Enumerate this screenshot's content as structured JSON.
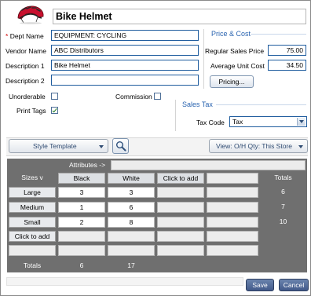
{
  "item": {
    "title": "Bike Helmet",
    "image_icon": "helmet-icon"
  },
  "form": {
    "dept_label": "Dept Name",
    "dept_required_mark": "*",
    "dept_value": "EQUIPMENT: CYCLING",
    "vendor_label": "Vendor Name",
    "vendor_value": "ABC Distributors",
    "desc1_label": "Description 1",
    "desc1_value": "Bike Helmet",
    "desc2_label": "Description 2",
    "desc2_value": "",
    "unorderable_label": "Unorderable",
    "unorderable_checked": false,
    "commission_label": "Commission",
    "commission_checked": false,
    "print_tags_label": "Print Tags",
    "print_tags_checked": true
  },
  "price": {
    "group_title": "Price & Cost",
    "regular_label": "Regular Sales Price",
    "regular_value": "75.00",
    "avg_cost_label": "Average Unit Cost",
    "avg_cost_value": "34.50",
    "pricing_button": "Pricing..."
  },
  "tax": {
    "group_title": "Sales Tax",
    "tax_code_label": "Tax Code",
    "tax_code_value": "Tax"
  },
  "toolbar": {
    "style_template_label": "Style Template",
    "search_icon": "magnifier-icon",
    "view_label": "View:  O/H Qty:  This Store"
  },
  "matrix": {
    "attributes_label": "Attributes ->",
    "sizes_label": "Sizes v",
    "totals_label": "Totals",
    "click_to_add": "Click to add",
    "columns": [
      "Black",
      "White"
    ],
    "rows": [
      {
        "size": "Large",
        "values": [
          "3",
          "3"
        ],
        "total": "6"
      },
      {
        "size": "Medium",
        "values": [
          "1",
          "6"
        ],
        "total": "7"
      },
      {
        "size": "Small",
        "values": [
          "2",
          "8"
        ],
        "total": "10"
      }
    ],
    "column_totals": [
      "6",
      "17"
    ]
  },
  "footer": {
    "save": "Save",
    "cancel": "Cancel"
  },
  "colors": {
    "accent_blue": "#2a64b0",
    "field_border": "#1f5c9e",
    "grid_dark": "#6f6f6f",
    "button_blue": "#4d6594"
  }
}
